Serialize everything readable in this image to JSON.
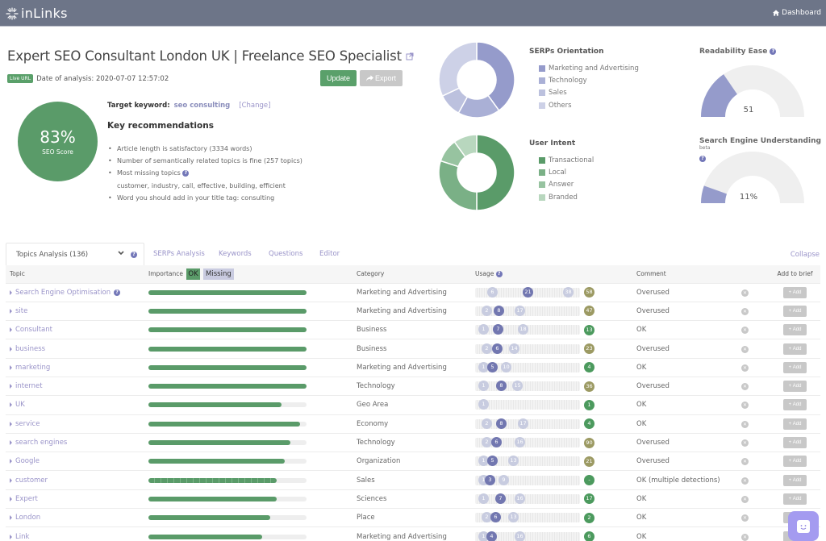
{
  "app": {
    "name": "inLinks",
    "nav_dashboard": "Dashboard"
  },
  "header": {
    "title": "Expert SEO Consultant London UK | Freelance SEO Specialist",
    "live_badge": "Live URL",
    "date_label": "Date of analysis: 2020-07-07 12:57:02",
    "update_label": "Update",
    "export_label": "Export"
  },
  "score": {
    "value": "83%",
    "label": "SEO Score"
  },
  "target": {
    "label": "Target keyword:",
    "keyword": "seo consulting",
    "change_label": "[Change]"
  },
  "recommendations": {
    "title": "Key recommendations",
    "items": [
      "Article length is satisfactory (3334 words)",
      "Number of semantically related topics is fine (257 topics)",
      "Most missing topics",
      "customer, industry, call, effective, building, efficient",
      "Word you should add in your title tag: consulting"
    ]
  },
  "serps_orientation": {
    "title": "SERPs Orientation",
    "legend": [
      {
        "label": "Marketing and Advertising",
        "color": "#959bcb",
        "share": 0.4
      },
      {
        "label": "Technology",
        "color": "#aab0d6",
        "share": 0.18
      },
      {
        "label": "Sales",
        "color": "#bcc1de",
        "share": 0.1
      },
      {
        "label": "Others",
        "color": "#cdd1e7",
        "share": 0.32
      }
    ]
  },
  "user_intent": {
    "title": "User Intent",
    "legend": [
      {
        "label": "Transactional",
        "color": "#5a9b69",
        "share": 0.5
      },
      {
        "label": "Local",
        "color": "#7ab086",
        "share": 0.3
      },
      {
        "label": "Answer",
        "color": "#97c3a0",
        "share": 0.1
      },
      {
        "label": "Branded",
        "color": "#b8d7be",
        "share": 0.1
      }
    ]
  },
  "readability": {
    "title": "Readability Ease",
    "value": "51",
    "fraction": 0.31
  },
  "seu": {
    "title": "Search Engine Understanding",
    "beta": "beta",
    "value": "11%",
    "fraction": 0.11
  },
  "tabs": {
    "active": "Topics Analysis (136)",
    "items": [
      "SERPs Analysis",
      "Keywords",
      "Questions",
      "Editor"
    ],
    "collapse": "Collapse"
  },
  "table": {
    "headers": {
      "topic": "Topic",
      "importance": "Importance",
      "ok": "OK",
      "missing": "Missing",
      "category": "Category",
      "usage": "Usage",
      "comment": "Comment",
      "add": "Add to brief"
    },
    "add_label": "Add",
    "rows": [
      {
        "topic": "Search Engine Optimisation",
        "help": true,
        "importance": 1.0,
        "category": "Marketing and Advertising",
        "usage": [
          "6",
          "21",
          "38"
        ],
        "usage_pos": [
          0.13,
          0.5,
          0.93
        ],
        "count": "58",
        "count_color": "#9c9a63",
        "comment": "Overused"
      },
      {
        "topic": "site",
        "importance": 1.0,
        "category": "Marketing and Advertising",
        "usage": [
          "2",
          "8",
          "17"
        ],
        "usage_pos": [
          0.07,
          0.2,
          0.42
        ],
        "count": "47",
        "count_color": "#9c9a63",
        "comment": "Overused"
      },
      {
        "topic": "Consultant",
        "importance": 1.0,
        "category": "Business",
        "usage": [
          "1",
          "7",
          "18"
        ],
        "usage_pos": [
          0.03,
          0.19,
          0.45
        ],
        "count": "13",
        "count_color": "#4c9a5e",
        "comment": "OK"
      },
      {
        "topic": "business",
        "importance": 1.0,
        "category": "Business",
        "usage": [
          "2",
          "6",
          "14"
        ],
        "usage_pos": [
          0.07,
          0.18,
          0.36
        ],
        "count": "23",
        "count_color": "#9c9a63",
        "comment": "Overused"
      },
      {
        "topic": "marketing",
        "importance": 1.0,
        "category": "Marketing and Advertising",
        "usage": [
          "1",
          "5",
          "10"
        ],
        "usage_pos": [
          0.03,
          0.13,
          0.27
        ],
        "count": "4",
        "count_color": "#4c9a5e",
        "comment": "OK"
      },
      {
        "topic": "internet",
        "importance": 1.0,
        "category": "Technology",
        "usage": [
          "1",
          "8",
          "15"
        ],
        "usage_pos": [
          0.03,
          0.22,
          0.39
        ],
        "count": "36",
        "count_color": "#9c9a63",
        "comment": "Overused"
      },
      {
        "topic": "UK",
        "importance": 0.84,
        "category": "Geo Area",
        "usage": [
          "1"
        ],
        "usage_pos": [
          0.03
        ],
        "count": "1",
        "count_color": "#4c9a5e",
        "comment": "OK"
      },
      {
        "topic": "service",
        "importance": 0.96,
        "category": "Economy",
        "usage": [
          "2",
          "8",
          "17"
        ],
        "usage_pos": [
          0.07,
          0.22,
          0.45
        ],
        "count": "4",
        "count_color": "#4c9a5e",
        "comment": "OK"
      },
      {
        "topic": "search engines",
        "importance": 0.9,
        "category": "Technology",
        "usage": [
          "2",
          "6",
          " 16"
        ],
        "usage_pos": [
          0.07,
          0.17,
          0.42
        ],
        "count": "90",
        "count_color": "#9c9a63",
        "comment": "Overused"
      },
      {
        "topic": "Google",
        "importance": 0.86,
        "category": "Organization",
        "usage": [
          "1",
          "5",
          "13"
        ],
        "usage_pos": [
          0.03,
          0.13,
          0.35
        ],
        "count": "21",
        "count_color": "#9c9a63",
        "comment": "Overused"
      },
      {
        "topic": "customer",
        "importance": 0.81,
        "dashed": true,
        "category": "Sales",
        "usage": [
          "1",
          "3",
          "9"
        ],
        "usage_pos": [
          0.03,
          0.1,
          0.25
        ],
        "count": "-",
        "count_color": "#4c9a5e",
        "comment": "OK (multiple detections)"
      },
      {
        "topic": "Expert",
        "importance": 0.81,
        "category": "Sciences",
        "usage": [
          "1",
          "7",
          "16"
        ],
        "usage_pos": [
          0.03,
          0.21,
          0.42
        ],
        "count": "17",
        "count_color": "#4c9a5e",
        "comment": "OK"
      },
      {
        "topic": "London",
        "importance": 0.77,
        "category": "Place",
        "usage": [
          "2",
          "6",
          "13"
        ],
        "usage_pos": [
          0.07,
          0.16,
          0.35
        ],
        "count": "2",
        "count_color": "#4c9a5e",
        "comment": "OK"
      },
      {
        "topic": "Link",
        "importance": 0.72,
        "category": "Marketing and Advertising",
        "usage": [
          "1",
          "4",
          "16"
        ],
        "usage_pos": [
          0.03,
          0.12,
          0.42
        ],
        "count": "6",
        "count_color": "#4c9a5e",
        "comment": "OK"
      }
    ]
  }
}
